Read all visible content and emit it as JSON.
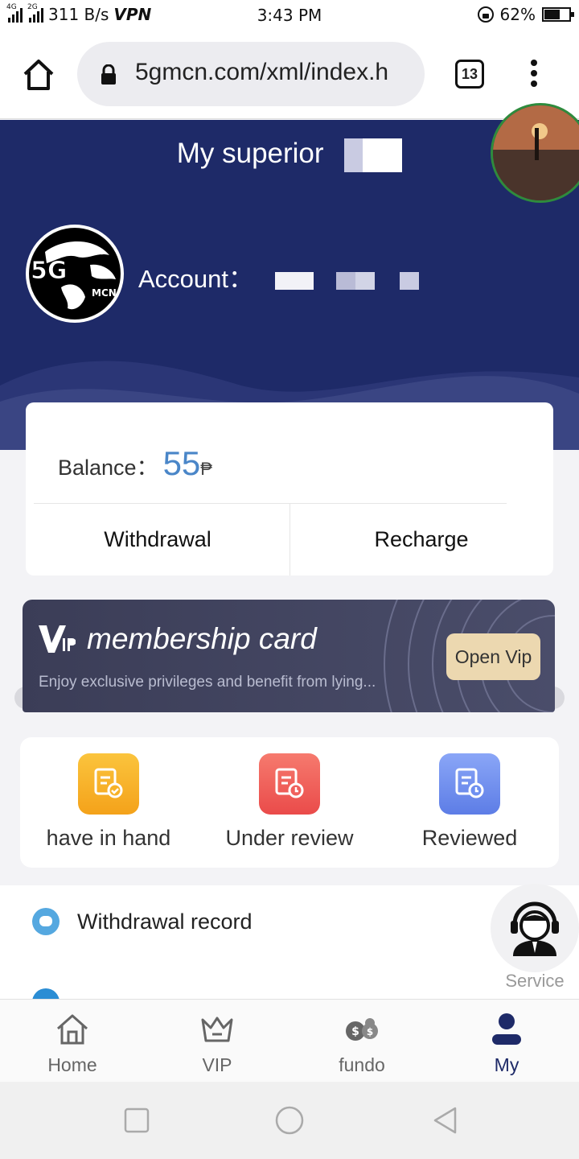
{
  "status_bar": {
    "signal1_tag": "4G",
    "signal2_tag": "2G",
    "net_speed": "311 B/s",
    "vpn": "VPN",
    "time": "3:43 PM",
    "battery": "62%",
    "battery_level": 0.62
  },
  "browser": {
    "url": "5gmcn.com/xml/index.h",
    "tab_count": "13"
  },
  "header": {
    "superior_label": "My superior",
    "logo_text": "5G",
    "logo_sub": "MCN",
    "account_label": "Account："
  },
  "balance": {
    "label": "Balance：",
    "value": "55",
    "currency": "₱",
    "withdrawal_label": "Withdrawal",
    "recharge_label": "Recharge"
  },
  "vip": {
    "title": "membership card",
    "subtitle": "Enjoy exclusive privileges and benefit from lying...",
    "button": "Open Vip",
    "colors": {
      "button_bg": "#ecd8b0",
      "card_bg": "#3b3d57"
    }
  },
  "orders": [
    {
      "label": "have in hand",
      "color": "#f7b228",
      "icon": "document-check-icon"
    },
    {
      "label": "Under review",
      "color": "#f0605c",
      "icon": "document-clock-icon"
    },
    {
      "label": "Reviewed",
      "color": "#6e8ff0",
      "icon": "document-clock-icon"
    }
  ],
  "list": {
    "withdrawal_record": "Withdrawal record"
  },
  "service": {
    "label": "Service"
  },
  "bottom_nav": [
    {
      "label": "Home",
      "icon": "home-icon"
    },
    {
      "label": "VIP",
      "icon": "crown-icon"
    },
    {
      "label": "fundo",
      "icon": "coins-icon"
    },
    {
      "label": "My",
      "icon": "user-icon",
      "active": true
    }
  ],
  "colors": {
    "primary": "#1e2a68",
    "accent": "#4a86c8"
  }
}
